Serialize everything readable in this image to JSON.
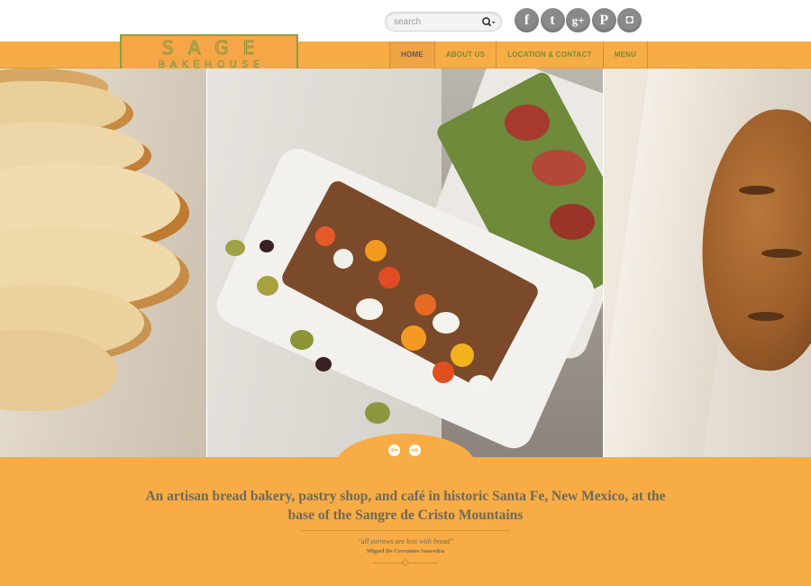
{
  "search": {
    "placeholder": "search"
  },
  "social": [
    {
      "icon": "facebook-icon",
      "glyph": "f"
    },
    {
      "icon": "twitter-icon",
      "glyph": "t"
    },
    {
      "icon": "google-plus-icon",
      "glyph": "g+"
    },
    {
      "icon": "pinterest-icon",
      "glyph": "P"
    },
    {
      "icon": "instagram-icon",
      "glyph": "◘"
    }
  ],
  "logo": {
    "line1": "SAGE",
    "line2": "BAKEHOUSE"
  },
  "nav": [
    {
      "label": "HOME",
      "active": true
    },
    {
      "label": "ABOUT US",
      "active": false
    },
    {
      "label": "LOCATION & CONTACT",
      "active": false
    },
    {
      "label": "MENU",
      "active": false
    }
  ],
  "slider": {
    "prev_glyph": "⇦",
    "next_glyph": "⇨"
  },
  "tagline": "An artisan bread bakery, pastry shop, and café in historic Santa Fe, New Mexico, at the base of the Sangre de Cristo Mountains",
  "quote": {
    "text": "\"all sorrows are less with bread\"",
    "author": "Miguel De Cervantes Saavedra"
  },
  "colors": {
    "orange": "#f7ac45",
    "olive": "#7f9741",
    "text": "#6e6a5a"
  }
}
